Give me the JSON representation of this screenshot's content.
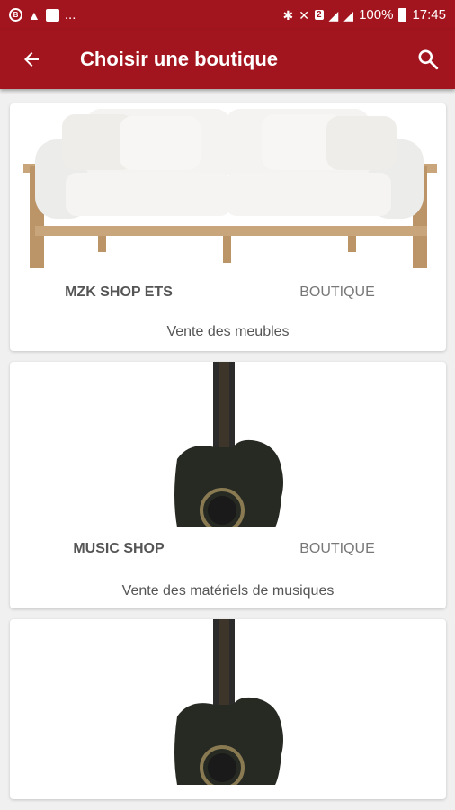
{
  "status_bar": {
    "left_icons": [
      "notification-circle-icon",
      "warning-icon",
      "message-icon"
    ],
    "more": "...",
    "sim_badge": "2",
    "battery": "100%",
    "time": "17:45"
  },
  "app_bar": {
    "title": "Choisir une boutique",
    "back_icon": "arrow-back-icon",
    "search_icon": "search-icon"
  },
  "shops": [
    {
      "name": "MZK SHOP ETS",
      "type": "BOUTIQUE",
      "description": "Vente des meubles",
      "image": "sofa"
    },
    {
      "name": "MUSIC SHOP",
      "type": "BOUTIQUE",
      "description": "Vente des matériels de musiques",
      "image": "guitar"
    },
    {
      "name": "",
      "type": "",
      "description": "",
      "image": "guitar"
    }
  ],
  "colors": {
    "primary": "#a3151e",
    "background": "#f0f0f0"
  }
}
